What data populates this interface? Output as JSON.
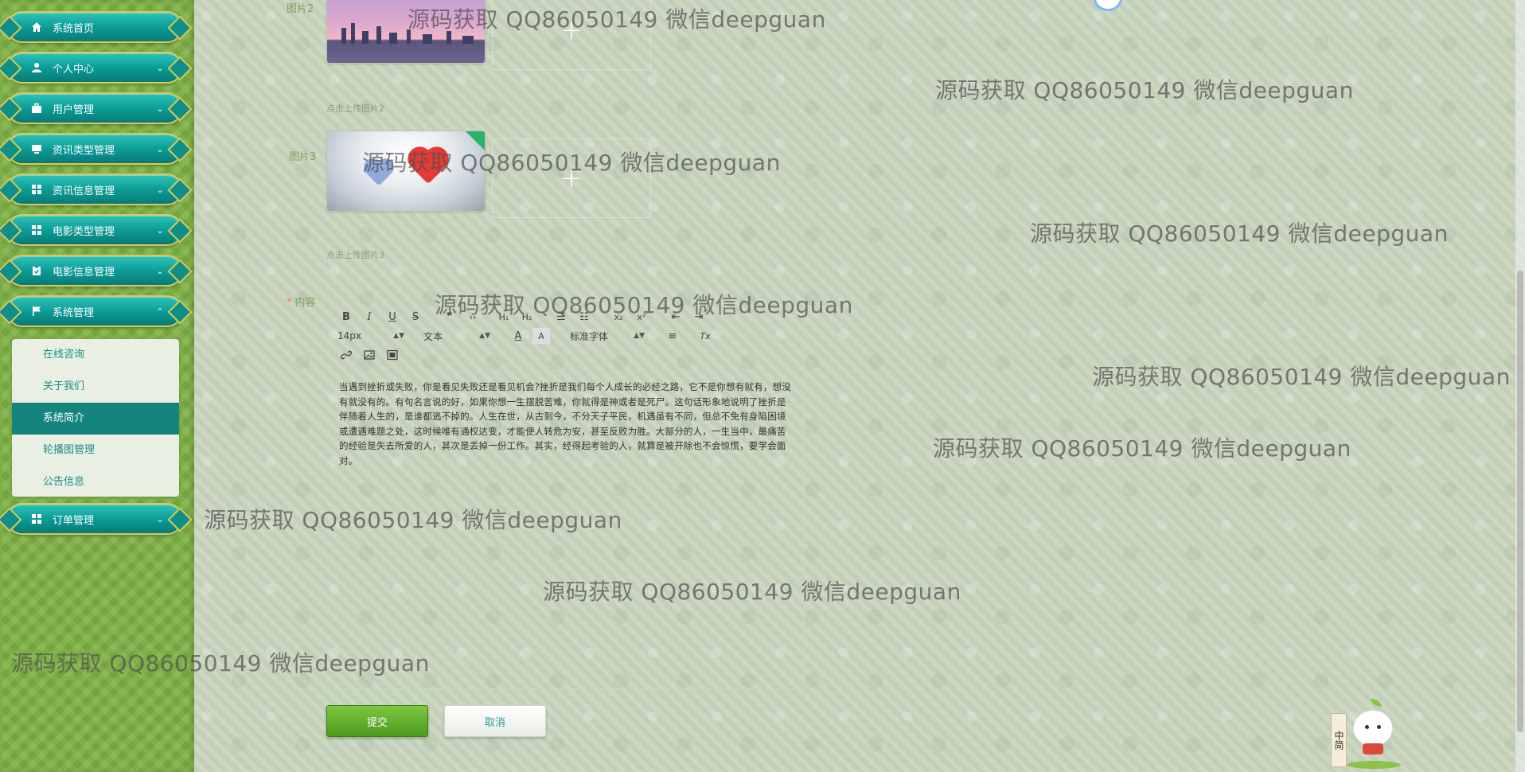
{
  "sidebar": {
    "menu": [
      {
        "label": "系统首页",
        "icon": "home-icon",
        "chevron": ""
      },
      {
        "label": "个人中心",
        "icon": "user-icon",
        "chevron": "⌄"
      },
      {
        "label": "用户管理",
        "icon": "briefcase-icon",
        "chevron": "⌄"
      },
      {
        "label": "资讯类型管理",
        "icon": "monitor-icon",
        "chevron": "⌄"
      },
      {
        "label": "资讯信息管理",
        "icon": "grid-icon",
        "chevron": "⌄"
      },
      {
        "label": "电影类型管理",
        "icon": "grid-icon",
        "chevron": "⌄"
      },
      {
        "label": "电影信息管理",
        "icon": "clipboard-icon",
        "chevron": "⌄"
      },
      {
        "label": "系统管理",
        "icon": "flag-icon",
        "chevron": "⌃"
      },
      {
        "label": "订单管理",
        "icon": "grid-icon",
        "chevron": "⌄"
      }
    ],
    "submenu": [
      "在线咨询",
      "关于我们",
      "系统简介",
      "轮播图管理",
      "公告信息"
    ],
    "active_submenu": "系统简介"
  },
  "form": {
    "image2_label": "图片2",
    "image2_hint": "点击上传图片2",
    "image3_label": "图片3",
    "image3_hint": "点击上传图片3",
    "content_label": "内容",
    "required_mark": "*",
    "upload_plus": "+",
    "toolbar": {
      "bold": "B",
      "italic": "I",
      "underline": "U",
      "strike": "S",
      "quote": "❞",
      "code": "‹›",
      "h1": "H₁",
      "h2": "H₂",
      "ordered": "☰",
      "bullet": "☷",
      "sub": "x₂",
      "sup": "x²",
      "outdent": "⇤",
      "indent": "⇥",
      "size": "14px",
      "header": "文本",
      "font": "标准字体",
      "color": "A",
      "bg": "A",
      "align": "≡",
      "clear": "Tx",
      "link": "🔗",
      "image": "▣",
      "video": "▤"
    },
    "content_text": "当遇到挫折或失败，你是看见失败还是看见机会?挫折是我们每个人成长的必经之路，它不是你想有就有，想没有就没有的。有句名言说的好，如果你想一生摆脱苦难，你就得是神或者是死尸。这句话形象地说明了挫折是伴随着人生的，是谁都逃不掉的。人生在世，从古到今，不分天子平民，机遇虽有不同，但总不免有身陷困境或遭遇难题之处，这时候唯有通权达变，才能使人转危为安，甚至反败为胜。大部分的人，一生当中，最痛苦的经验是失去所爱的人，其次是丢掉一份工作。其实，经得起考验的人，就算是被开除也不会惊慌，要学会面对。",
    "submit": "提交",
    "cancel": "取消"
  },
  "watermark": "源码获取 QQ86050149 微信deepguan",
  "mascot_sign": "中简",
  "colors": {
    "sidebar_bg": "#7db043",
    "menu_teal": "#0c9c97",
    "menu_border": "#d9c95a",
    "submit_green": "#4e9a1e",
    "label_green": "#7f9f5a"
  }
}
